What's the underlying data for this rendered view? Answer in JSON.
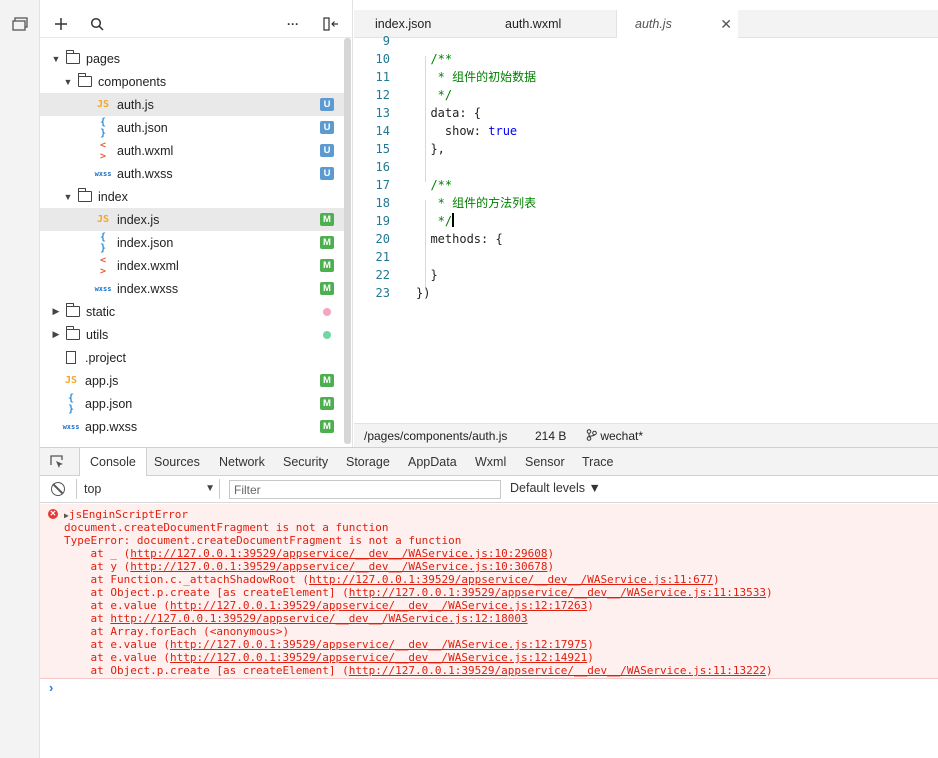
{
  "toolbar": {
    "more_label": "···"
  },
  "explorer": {
    "tree": [
      {
        "label": "pages",
        "kind": "folder",
        "expanded": true,
        "depth": 0
      },
      {
        "label": "components",
        "kind": "folder",
        "expanded": true,
        "depth": 1
      },
      {
        "label": "auth.js",
        "kind": "js",
        "depth": 2,
        "badge": "U",
        "selected": true
      },
      {
        "label": "auth.json",
        "kind": "json",
        "depth": 2,
        "badge": "U"
      },
      {
        "label": "auth.wxml",
        "kind": "wxml",
        "depth": 2,
        "badge": "U"
      },
      {
        "label": "auth.wxss",
        "kind": "wxss",
        "depth": 2,
        "badge": "U"
      },
      {
        "label": "index",
        "kind": "folder",
        "expanded": true,
        "depth": 1
      },
      {
        "label": "index.js",
        "kind": "js",
        "depth": 2,
        "badge": "M",
        "selected": true
      },
      {
        "label": "index.json",
        "kind": "json",
        "depth": 2,
        "badge": "M"
      },
      {
        "label": "index.wxml",
        "kind": "wxml",
        "depth": 2,
        "badge": "M"
      },
      {
        "label": "index.wxss",
        "kind": "wxss",
        "depth": 2,
        "badge": "M"
      },
      {
        "label": "static",
        "kind": "folder",
        "expanded": false,
        "depth": 0,
        "dot": "#f4a6c0"
      },
      {
        "label": "utils",
        "kind": "folder",
        "expanded": false,
        "depth": 0,
        "dot": "#6fd6a6"
      },
      {
        "label": ".project",
        "kind": "file",
        "depth": 0
      },
      {
        "label": "app.js",
        "kind": "js",
        "depth": 0,
        "badge": "M"
      },
      {
        "label": "app.json",
        "kind": "json",
        "depth": 0,
        "badge": "M"
      },
      {
        "label": "app.wxss",
        "kind": "wxss",
        "depth": 0,
        "badge": "M"
      }
    ],
    "icon_glyphs": {
      "js": "JS",
      "json": "{ }",
      "wxml": "< >",
      "wxss": "wxss"
    }
  },
  "editor": {
    "tabs": [
      {
        "label": "index.json",
        "active": false
      },
      {
        "label": "auth.wxml",
        "active": false
      },
      {
        "label": "auth.js",
        "active": true
      }
    ],
    "close_glyph": "✕",
    "lines": [
      {
        "n": "9",
        "code": ""
      },
      {
        "n": "10",
        "code": "  /**",
        "cls": "c-cm"
      },
      {
        "n": "11",
        "code": "   * 组件的初始数据",
        "cls": "c-cm"
      },
      {
        "n": "12",
        "code": "   */",
        "cls": "c-cm"
      },
      {
        "n": "13",
        "code": "  data: {",
        "cls": "c-id"
      },
      {
        "n": "14",
        "code": "    show: ",
        "cls": "c-id",
        "tail": "true",
        "tail_cls": "c-kw"
      },
      {
        "n": "15",
        "code": "  },",
        "cls": "c-id"
      },
      {
        "n": "16",
        "code": ""
      },
      {
        "n": "17",
        "code": "  /**",
        "cls": "c-cm"
      },
      {
        "n": "18",
        "code": "   * 组件的方法列表",
        "cls": "c-cm"
      },
      {
        "n": "19",
        "code": "   */",
        "cls": "c-cm",
        "cursor": true
      },
      {
        "n": "20",
        "code": "  methods: {",
        "cls": "c-id"
      },
      {
        "n": "21",
        "code": ""
      },
      {
        "n": "22",
        "code": "  }",
        "cls": "c-id"
      },
      {
        "n": "23",
        "code": "})",
        "cls": "c-id"
      }
    ]
  },
  "statusbar": {
    "path": "/pages/components/auth.js",
    "size": "214 B",
    "branch": "wechat*"
  },
  "devtools": {
    "tabs": [
      "Console",
      "Sources",
      "Network",
      "Security",
      "Storage",
      "AppData",
      "Wxml",
      "Sensor",
      "Trace"
    ],
    "active_tab": "Console",
    "context": "top",
    "filter_placeholder": "Filter",
    "levels": "Default levels ▼",
    "error": {
      "title": "jsEnginScriptError",
      "lines": [
        {
          "text": "document.createDocumentFragment is not a function"
        },
        {
          "text": "TypeError: document.createDocumentFragment is not a function"
        },
        {
          "pre": "    at _ (",
          "link": "http://127.0.0.1:39529/appservice/__dev__/WAService.js:10:29608",
          "post": ")"
        },
        {
          "pre": "    at y (",
          "link": "http://127.0.0.1:39529/appservice/__dev__/WAService.js:10:30678",
          "post": ")"
        },
        {
          "pre": "    at Function.c._attachShadowRoot (",
          "link": "http://127.0.0.1:39529/appservice/__dev__/WAService.js:11:677",
          "post": ")"
        },
        {
          "pre": "    at Object.p.create [as createElement] (",
          "link": "http://127.0.0.1:39529/appservice/__dev__/WAService.js:11:13533",
          "post": ")"
        },
        {
          "pre": "    at e.value (",
          "link": "http://127.0.0.1:39529/appservice/__dev__/WAService.js:12:17263",
          "post": ")"
        },
        {
          "pre": "    at ",
          "link": "http://127.0.0.1:39529/appservice/__dev__/WAService.js:12:18003",
          "post": ""
        },
        {
          "text": "    at Array.forEach (<anonymous>)"
        },
        {
          "pre": "    at e.value (",
          "link": "http://127.0.0.1:39529/appservice/__dev__/WAService.js:12:17975",
          "post": ")"
        },
        {
          "pre": "    at e.value (",
          "link": "http://127.0.0.1:39529/appservice/__dev__/WAService.js:12:14921",
          "post": ")"
        },
        {
          "pre": "    at Object.p.create [as createElement] (",
          "link": "http://127.0.0.1:39529/appservice/__dev__/WAService.js:11:13222",
          "post": ")"
        }
      ]
    },
    "prompt": "›"
  }
}
